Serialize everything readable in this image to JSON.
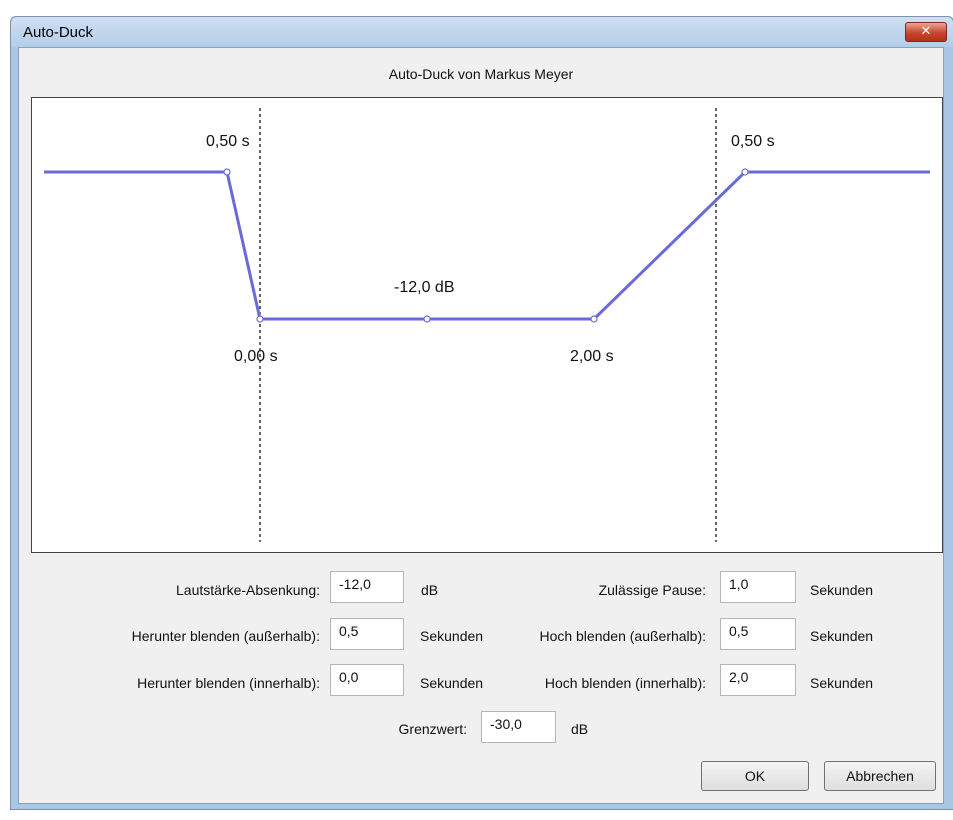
{
  "window": {
    "title": "Auto-Duck",
    "close_glyph": "✕"
  },
  "subtitle": "Auto-Duck von Markus Meyer",
  "graph": {
    "label_outer_fade_down": "0,50 s",
    "label_outer_fade_up": "0,50 s",
    "label_inner_fade_down": "0,00 s",
    "label_inner_fade_up": "2,00 s",
    "label_duck_amount": "-12,0 dB",
    "line_color": "#6a6ad8"
  },
  "form": {
    "duck_amount": {
      "label": "Lautstärke-Absenkung:",
      "value": "-12,0",
      "unit": "dB"
    },
    "max_pause": {
      "label": "Zulässige Pause:",
      "value": "1,0",
      "unit": "Sekunden"
    },
    "outer_fade_down": {
      "label": "Herunter blenden (außerhalb):",
      "value": "0,5",
      "unit": "Sekunden"
    },
    "outer_fade_up": {
      "label": "Hoch blenden (außerhalb):",
      "value": "0,5",
      "unit": "Sekunden"
    },
    "inner_fade_down": {
      "label": "Herunter blenden (innerhalb):",
      "value": "0,0",
      "unit": "Sekunden"
    },
    "inner_fade_up": {
      "label": "Hoch blenden (innerhalb):",
      "value": "2,0",
      "unit": "Sekunden"
    },
    "threshold": {
      "label": "Grenzwert:",
      "value": "-30,0",
      "unit": "dB"
    }
  },
  "buttons": {
    "ok": "OK",
    "cancel": "Abbrechen"
  }
}
